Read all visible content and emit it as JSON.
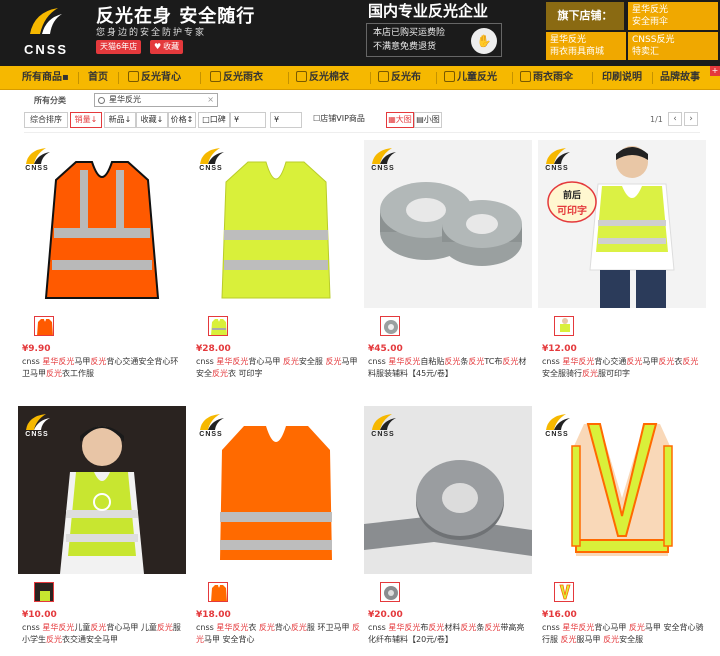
{
  "header": {
    "brand": "CNSS",
    "slogan": "反光在身 安全随行",
    "subslogan": "您身边的安全防护专家",
    "badge": "天猫6年店",
    "favorite": "收藏",
    "domestic": "国内专业反光企业",
    "policy_line1": "本店已购买运费险",
    "policy_line2": "不满意免费退货",
    "stores_title": "旗下店铺：",
    "stores": [
      {
        "line1": "星华反光",
        "line2": "安全雨伞"
      },
      {
        "line1": "星华反光",
        "line2": "雨衣雨具商城"
      },
      {
        "line1": "CNSS反光",
        "line2": "特卖汇"
      }
    ]
  },
  "nav": {
    "items": [
      {
        "label": "所有商品",
        "suffix": "▪",
        "icon": "none"
      },
      {
        "label": "首页",
        "icon": "none"
      },
      {
        "label": "反光背心",
        "icon": "vest-icon"
      },
      {
        "label": "反光雨衣",
        "icon": "raincoat-icon"
      },
      {
        "label": "反光棉衣",
        "icon": "coat-icon"
      },
      {
        "label": "反光布",
        "icon": "fabric-icon"
      },
      {
        "label": "儿童反光",
        "icon": "child-icon"
      },
      {
        "label": "雨衣雨伞",
        "icon": "umbrella-icon"
      },
      {
        "label": "印刷说明",
        "icon": "none"
      },
      {
        "label": "品牌故事",
        "icon": "none"
      }
    ]
  },
  "crumb": {
    "label": "所有分类",
    "value": "星华反光"
  },
  "filters": {
    "sort_all": "综合排序",
    "sales": "销量",
    "new": "新品",
    "favorites": "收藏",
    "price": "价格",
    "price_input": "口碑",
    "price_from_placeholder": "¥",
    "price_to_placeholder": "¥",
    "vip": "店铺VIP商品",
    "big_view": "大图",
    "small_view": "小图",
    "page_info": "1/1"
  },
  "products": [
    {
      "price": "¥9.90",
      "title_parts": [
        "cnss ",
        "星华反光",
        "马甲",
        "反光",
        "背心交通安全背心环卫马甲",
        "反光",
        "衣工作服"
      ],
      "color": "#ff5a00"
    },
    {
      "price": "¥28.00",
      "title_parts": [
        "cnss ",
        "星华反光",
        "背心马甲 ",
        "反光",
        "安全服 ",
        "反光",
        "马甲 安全",
        "反光",
        "衣 可印字"
      ],
      "color": "#d9f03a"
    },
    {
      "price": "¥45.00",
      "title_parts": [
        "cnss ",
        "星华反光",
        "自粘贴",
        "反光",
        "条",
        "反光",
        "TC布",
        "反光",
        "材料服装辅料【45元/卷】"
      ],
      "color": "#9aa0a0"
    },
    {
      "price": "¥12.00",
      "title_parts": [
        "cnss ",
        "星华反光",
        "背心交通",
        "反光",
        "马甲",
        "反光",
        "衣",
        "反光",
        "安全服骑行",
        "反光",
        "服可印字"
      ],
      "color": "#d9f03a"
    },
    {
      "price": "¥10.00",
      "title_parts": [
        "cnss ",
        "星华反光",
        "儿童",
        "反光",
        "背心马甲 儿童",
        "反光",
        "服 小学生",
        "反光",
        "衣交通安全马甲"
      ],
      "color": "#c8e630"
    },
    {
      "price": "¥18.00",
      "title_parts": [
        "cnss ",
        "星华反光",
        "衣 ",
        "反光",
        "背心",
        "反光",
        "服 环卫马甲 ",
        "反光",
        "马甲 安全背心"
      ],
      "color": "#ff6a00"
    },
    {
      "price": "¥20.00",
      "title_parts": [
        "cnss ",
        "星华反光",
        "布",
        "反光",
        "材料",
        "反光",
        "条",
        "反光",
        "带高亮化纤布辅料【20元/卷】"
      ],
      "color": "#8a8d90"
    },
    {
      "price": "¥16.00",
      "title_parts": [
        "cnss ",
        "星华反光",
        "背心马甲 ",
        "反光",
        "马甲 安全背心骑行服 ",
        "反光",
        "服马甲 ",
        "反光",
        "安全服"
      ],
      "color": "#d9f03a"
    }
  ],
  "overlay_text": {
    "print_label_1": "前后",
    "print_label_2": "可印字"
  }
}
